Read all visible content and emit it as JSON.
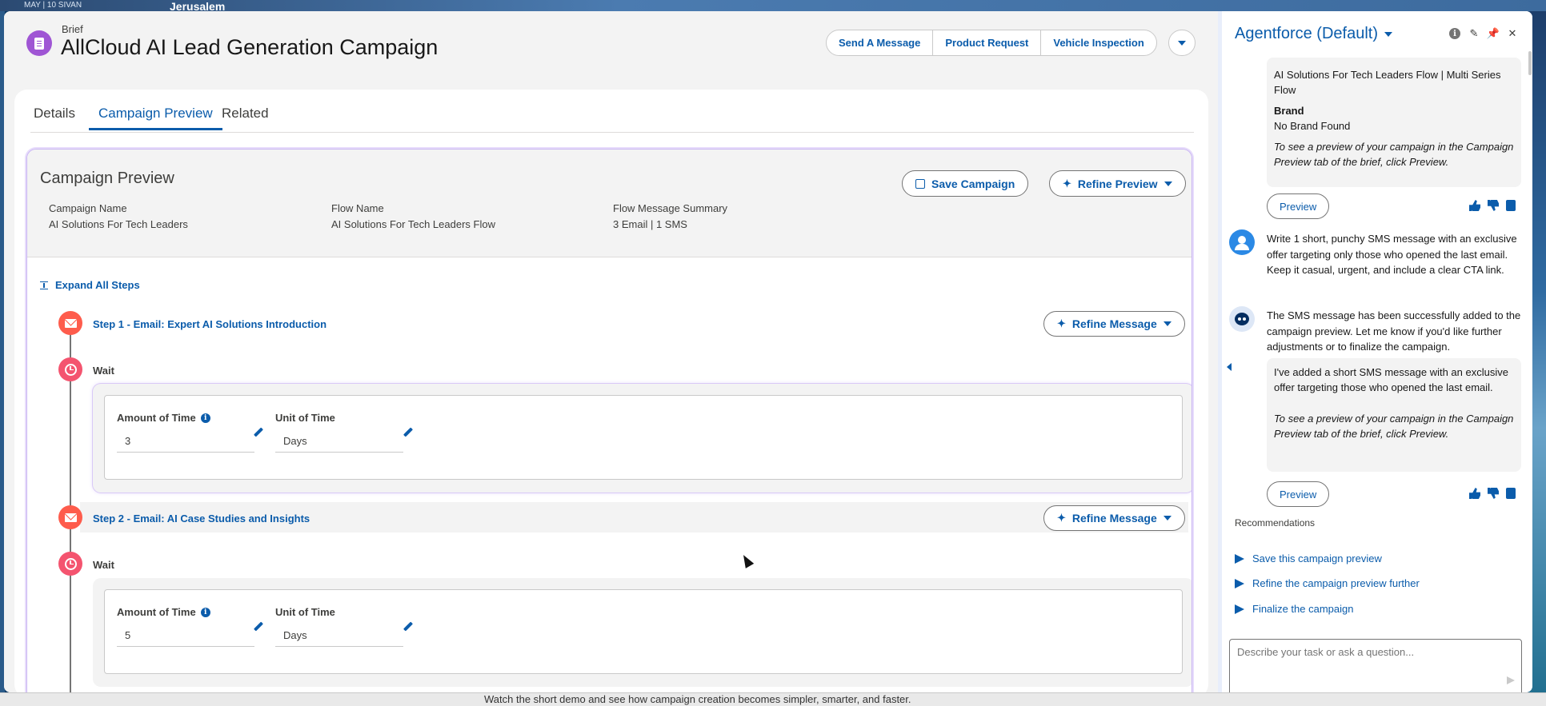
{
  "desktop": {
    "date_text": "MAY  |  10 SIVAN",
    "city": "Jerusalem",
    "video_caption": "Watch the short demo and see how campaign creation becomes simpler, smarter, and faster."
  },
  "header": {
    "object_label": "Brief",
    "title": "AllCloud AI Lead Generation Campaign",
    "actions": [
      "Send A Message",
      "Product Request",
      "Vehicle Inspection"
    ]
  },
  "tabs": [
    "Details",
    "Campaign Preview",
    "Related"
  ],
  "active_tab": "Campaign Preview",
  "preview": {
    "title": "Campaign Preview",
    "save_label": "Save Campaign",
    "refine_label": "Refine Preview",
    "fields": [
      {
        "label": "Campaign Name",
        "value": "AI Solutions For Tech Leaders"
      },
      {
        "label": "Flow Name",
        "value": "AI Solutions For Tech Leaders Flow"
      },
      {
        "label": "Flow Message Summary",
        "value": "3 Email | 1 SMS"
      }
    ],
    "expand_label": "Expand All Steps"
  },
  "steps": [
    {
      "title": "Step 1 - Email: Expert AI Solutions Introduction",
      "refine_label": "Refine Message"
    },
    {
      "title": "Step 2 - Email: AI Case Studies and Insights",
      "refine_label": "Refine Message"
    }
  ],
  "waits": [
    {
      "label": "Wait",
      "amount_label": "Amount of Time",
      "amount": "3",
      "unit_label": "Unit of Time",
      "unit": "Days"
    },
    {
      "label": "Wait",
      "amount_label": "Amount of Time",
      "amount": "5",
      "unit_label": "Unit of Time",
      "unit": "Days"
    }
  ],
  "agent": {
    "title": "Agentforce (Default)",
    "bubble1": {
      "flow_text": "AI Solutions For Tech Leaders Flow | Multi Series Flow",
      "brand_label": "Brand",
      "brand_value": "No Brand Found",
      "hint": "To see a preview of your campaign in the Campaign Preview tab of the brief, click Preview."
    },
    "preview_label": "Preview",
    "user_message": "Write 1 short, punchy SMS message with an exclusive offer targeting only those who opened the last email. Keep it casual, urgent, and include a clear CTA link.",
    "bot_message": "The SMS message has been successfully added to the campaign preview. Let me know if you'd like further adjustments or to finalize the campaign.",
    "bubble2": {
      "text": "I've added a short SMS message with an exclusive offer targeting those who opened the last email.",
      "hint": "To see a preview of your campaign in the Campaign Preview tab of the brief, click Preview."
    },
    "recommendations_label": "Recommendations",
    "recommendations": [
      "Save this campaign preview",
      "Refine the campaign preview further",
      "Finalize the campaign"
    ],
    "input_placeholder": "Describe your task or ask a question..."
  },
  "colors": {
    "brand_blue": "#0b5cab",
    "email_icon": "#fe5c4c",
    "wait_icon": "#f4546f",
    "record_icon": "#9f55d4"
  }
}
